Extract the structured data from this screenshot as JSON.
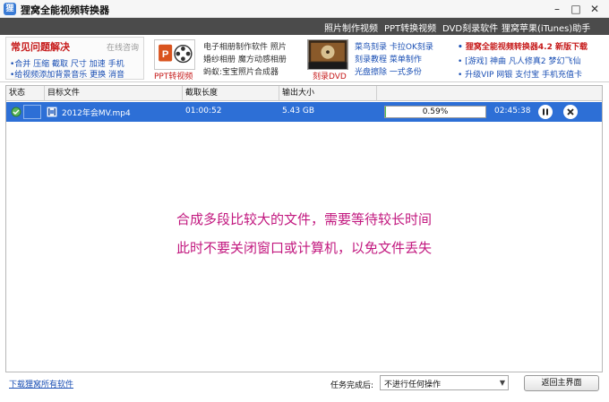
{
  "window": {
    "title": "狸窝全能视频转换器",
    "controls": {
      "minimize": "–",
      "maximize": "□",
      "close": "✕"
    }
  },
  "menu": {
    "items": [
      "照片制作视频",
      "PPT转换视频",
      "DVD刻录软件",
      "狸窝苹果(iTunes)助手"
    ]
  },
  "banner": {
    "faq": {
      "title": "常见问题解决",
      "online": "在线咨询",
      "line1": "•合并 压缩 截取 尺寸 加速 手机",
      "line2": "•给视频添加背景音乐 更换 消音"
    },
    "ppt": {
      "caption": "PPT转视频",
      "line1": "电子相册制作软件 照片",
      "line2": "婚纱相册 魔方动感相册",
      "line3": "蚂蚁:宝宝照片合成器"
    },
    "dvd": {
      "caption": "刻录DVD",
      "line1": "菜鸟刻录 卡拉OK刻录",
      "line2": "刻录教程 菜单制作",
      "line3": "光盘擦除 一式多份"
    },
    "right": {
      "line1": "狸窝全能视频转换器4.2 新版下载",
      "line2": "[游戏] 神曲 凡人修真2 梦幻飞仙",
      "line3": "升级VIP 网银 支付宝 手机充值卡"
    }
  },
  "table": {
    "headers": [
      "状态",
      "目标文件",
      "截取长度",
      "输出大小",
      ""
    ],
    "rows": [
      {
        "file": "2012年会MV.mp4",
        "length": "01:00:52",
        "size": "5.43 GB",
        "progress_label": "0.59%",
        "progress": 0.0059,
        "remaining": "02:45:38"
      }
    ]
  },
  "notice": {
    "line1": "合成多段比较大的文件，需要等待较长时间",
    "line2": "此时不要关闭窗口或计算机，以免文件丢失"
  },
  "footer": {
    "download_link": "下载狸窝所有软件",
    "task_label": "任务完成后:",
    "task_value": "不进行任何操作",
    "back_button": "返回主界面"
  },
  "colors": {
    "menubar": "#4b4b4b",
    "row_selected": "#2d6fd6",
    "notice": "#c2187f",
    "faq_title": "#c61a1a",
    "progress": "#4cc24c"
  }
}
